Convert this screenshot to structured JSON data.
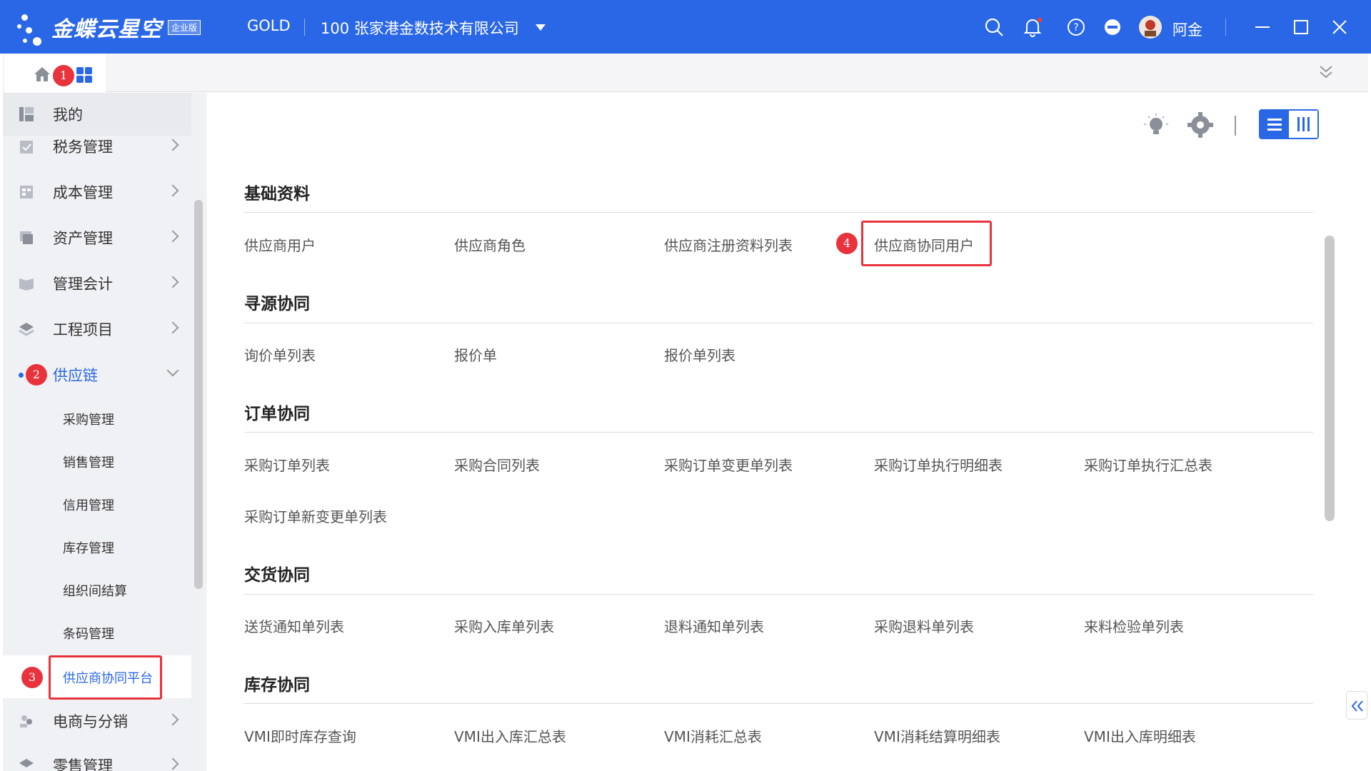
{
  "topbar": {
    "logo_text": "金蝶云星空",
    "logo_badge": "企业版",
    "gold": "GOLD",
    "company": "100  张家港金数技术有限公司",
    "username": "阿金"
  },
  "badges": {
    "b1": "1",
    "b2": "2",
    "b3": "3",
    "b4": "4"
  },
  "sidebar": {
    "items": [
      {
        "label": "我的"
      },
      {
        "label": "税务管理"
      },
      {
        "label": "成本管理"
      },
      {
        "label": "资产管理"
      },
      {
        "label": "管理会计"
      },
      {
        "label": "工程项目"
      },
      {
        "label": "供应链"
      },
      {
        "label": "电商与分销"
      },
      {
        "label": "零售管理"
      }
    ],
    "sub_items": [
      {
        "label": "采购管理"
      },
      {
        "label": "销售管理"
      },
      {
        "label": "信用管理"
      },
      {
        "label": "库存管理"
      },
      {
        "label": "组织间结算"
      },
      {
        "label": "条码管理"
      },
      {
        "label": "供应商协同平台"
      }
    ]
  },
  "sections": [
    {
      "title": "基础资料",
      "links": [
        "供应商用户",
        "供应商角色",
        "供应商注册资料列表",
        "供应商协同用户"
      ]
    },
    {
      "title": "寻源协同",
      "links": [
        "询价单列表",
        "报价单",
        "报价单列表"
      ]
    },
    {
      "title": "订单协同",
      "links": [
        "采购订单列表",
        "采购合同列表",
        "采购订单变更单列表",
        "采购订单执行明细表",
        "采购订单执行汇总表",
        "采购订单新变更单列表"
      ]
    },
    {
      "title": "交货协同",
      "links": [
        "送货通知单列表",
        "采购入库单列表",
        "退料通知单列表",
        "采购退料单列表",
        "来料检验单列表"
      ]
    },
    {
      "title": "库存协同",
      "links": [
        "VMI即时库存查询",
        "VMI出入库汇总表",
        "VMI消耗汇总表",
        "VMI消耗结算明细表",
        "VMI出入库明细表"
      ]
    }
  ],
  "colors": {
    "brand": "#2a67e6",
    "highlight": "#e8333d",
    "active": "#2a67e6"
  }
}
